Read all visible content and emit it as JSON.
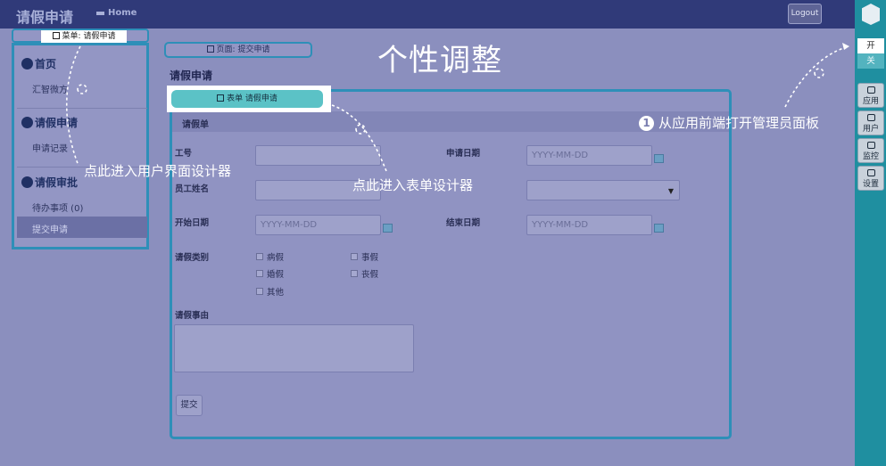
{
  "topbar": {
    "brand": "请假申请",
    "home": "Home",
    "logout": "Logout"
  },
  "menu_chip": "菜单: 请假申请",
  "page_chip": "页面: 提交申请",
  "form_chip": "表单 请假申请",
  "overlay_title": "个性调整",
  "sidebar": {
    "sec1": "首页",
    "sec1_item": "汇智微方",
    "sec2": "请假申请",
    "sec2_item": "申请记录",
    "sec3": "请假审批",
    "sec3_item1": "待办事项 (0)",
    "sec3_item2": "提交申请"
  },
  "page_title": "请假申请",
  "form": {
    "header": "请假单",
    "emp_no_label": "工号",
    "emp_name_label": "员工姓名",
    "apply_date_label": "申请日期",
    "apply_date_placeholder": "YYYY-MM-DD",
    "start_label": "开始日期",
    "start_placeholder": "YYYY-MM-DD",
    "end_label": "结束日期",
    "end_placeholder": "YYYY-MM-DD",
    "type_label": "请假类别",
    "types": [
      "病假",
      "事假",
      "婚假",
      "丧假",
      "其他"
    ],
    "reason_label": "请假事由",
    "submit": "提交"
  },
  "annotations": {
    "ui_designer": "点此进入用户界面设计器",
    "form_designer": "点此进入表单设计器",
    "admin_num": "1",
    "admin_panel": "从应用前端打开管理员面板"
  },
  "toolbar": {
    "on": "开",
    "off": "关",
    "app": "应用",
    "user": "用户",
    "monitor": "监控",
    "settings": "设置"
  },
  "colors": {
    "accent": "#2e8fb8",
    "toolbar": "#1f8fa0",
    "header": "#303a79"
  }
}
